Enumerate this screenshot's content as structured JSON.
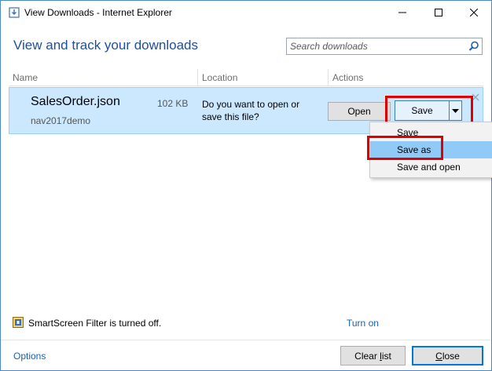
{
  "window": {
    "title": "View Downloads - Internet Explorer"
  },
  "header": {
    "title": "View and track your downloads",
    "search_placeholder": "Search downloads"
  },
  "columns": {
    "name": "Name",
    "location": "Location",
    "actions": "Actions"
  },
  "download": {
    "file_name": "SalesOrder.json",
    "file_size": "102 KB",
    "source": "nav2017demo",
    "prompt": "Do you want to open or save this file?",
    "open_label": "Open",
    "save_label": "Save"
  },
  "save_menu": {
    "items": [
      {
        "label": "Save",
        "selected": false
      },
      {
        "label": "Save as",
        "selected": true
      },
      {
        "label": "Save and open",
        "selected": false
      }
    ]
  },
  "footer": {
    "smartscreen_text": "SmartScreen Filter is turned off.",
    "turn_on_label": "Turn on",
    "options_label": "Options",
    "clear_list_pre": "Clear ",
    "clear_list_accel": "l",
    "clear_list_post": "ist",
    "close_accel": "C",
    "close_post": "lose"
  },
  "colors": {
    "accent": "#1f4e9c",
    "link": "#1a5fb4",
    "row_selected": "#cce8ff",
    "menu_selected": "#91c9f7",
    "highlight": "#e00000"
  }
}
